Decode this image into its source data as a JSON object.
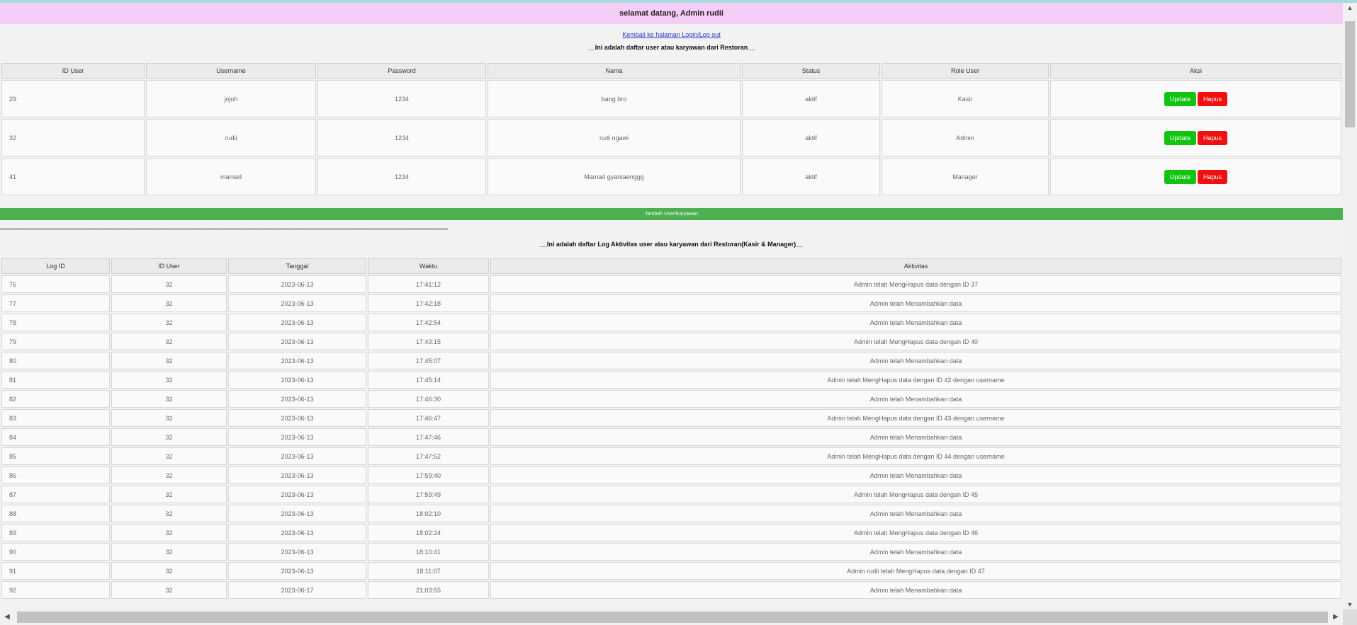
{
  "welcome": "selamat datang, Admin rudii",
  "back_link": "Kembali ke halaman Login/Log out",
  "users_heading": "__Ini adalah daftar user atau karyawan dari Restoran__",
  "users_table": {
    "headers": [
      "ID User",
      "Username",
      "Password",
      "Nama",
      "Status",
      "Role User",
      "Aksi"
    ],
    "rows": [
      [
        "29",
        "jojoh",
        "1234",
        "bang bro",
        "aktif",
        "Kasir"
      ],
      [
        "32",
        "rudii",
        "1234",
        "rudi ngawi",
        "aktif",
        "Admin"
      ],
      [
        "41",
        "mamad",
        "1234",
        "Mamad gyantaenggg",
        "aktif",
        "Manager"
      ]
    ],
    "update_label": "Update",
    "hapus_label": "Hapus"
  },
  "add_button": "Tambah User/Karyawan",
  "divider": "==================================================================================================================================================================================",
  "logs_heading": "__Ini adalah daftar Log Aktivitas user atau karyawan dari Restoran(Kasir & Manager)__",
  "logs_table": {
    "headers": [
      "Log ID",
      "ID User",
      "Tanggal",
      "Waktu",
      "Aktivitas"
    ],
    "rows": [
      [
        "76",
        "32",
        "2023-06-13",
        "17:41:12",
        "Admin telah MengHapus data dengan ID 37"
      ],
      [
        "77",
        "32",
        "2023-06-13",
        "17:42:18",
        "Admin telah Menambahkan data"
      ],
      [
        "78",
        "32",
        "2023-06-13",
        "17:42:54",
        "Admin telah Menambahkan data"
      ],
      [
        "79",
        "32",
        "2023-06-13",
        "17:43:15",
        "Admin telah MengHapus data dengan ID 40"
      ],
      [
        "80",
        "32",
        "2023-06-13",
        "17:45:07",
        "Admin telah Menambahkan data"
      ],
      [
        "81",
        "32",
        "2023-06-13",
        "17:45:14",
        "Admin telah MengHapus data dengan ID 42 dengan username"
      ],
      [
        "82",
        "32",
        "2023-06-13",
        "17:46:30",
        "Admin telah Menambahkan data"
      ],
      [
        "83",
        "32",
        "2023-06-13",
        "17:46:47",
        "Admin telah MengHapus data dengan ID 43 dengan username"
      ],
      [
        "84",
        "32",
        "2023-06-13",
        "17:47:46",
        "Admin telah Menambahkan data"
      ],
      [
        "85",
        "32",
        "2023-06-13",
        "17:47:52",
        "Admin telah MengHapus data dengan ID 44 dengan username"
      ],
      [
        "86",
        "32",
        "2023-06-13",
        "17:59:40",
        "Admin telah Menambahkan data"
      ],
      [
        "87",
        "32",
        "2023-06-13",
        "17:59:49",
        "Admin telah MengHapus data dengan ID 45"
      ],
      [
        "88",
        "32",
        "2023-06-13",
        "18:02:10",
        "Admin telah Menambahkan data"
      ],
      [
        "89",
        "32",
        "2023-06-13",
        "18:02:24",
        "Admin telah MengHapus data dengan ID 46"
      ],
      [
        "90",
        "32",
        "2023-06-13",
        "18:10:41",
        "Admin telah Menambahkan data"
      ],
      [
        "91",
        "32",
        "2023-06-13",
        "18:11:07",
        "Admin rudii telah MengHapus data dengan ID 47"
      ],
      [
        "92",
        "32",
        "2023-06-17",
        "21:03:55",
        "Admin telah Menambahkan data"
      ]
    ]
  },
  "scrollbar": {
    "up_icon": "arrow-up-icon",
    "down_icon": "arrow-down-icon",
    "left_icon": "arrow-left-icon",
    "right_icon": "arrow-right-icon"
  }
}
